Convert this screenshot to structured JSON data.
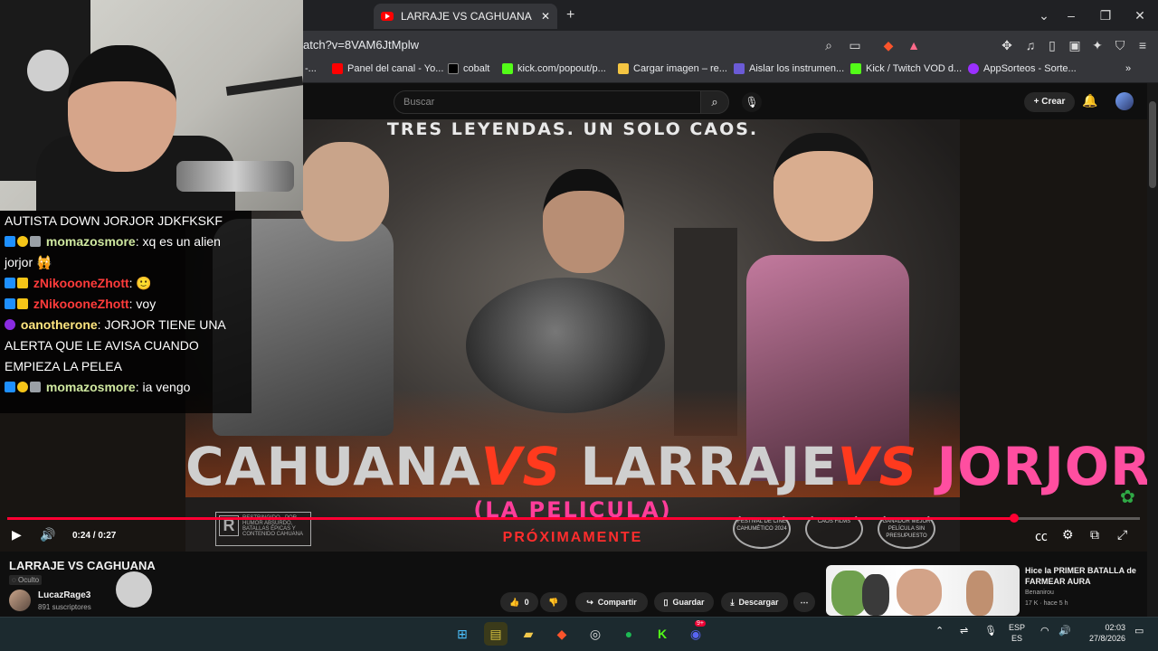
{
  "browser": {
    "tab_title": "LARRAJE VS CAGHUANA - YouTu",
    "new_tab": "+",
    "url": "atch?v=8VAM6JtMplw",
    "window_controls": {
      "collapse": "⌄",
      "minimize": "–",
      "restore": "❐",
      "close": "✕"
    },
    "bookmarks": [
      {
        "label": "-..."
      },
      {
        "label": "Panel del canal - Yo..."
      },
      {
        "label": "cobalt"
      },
      {
        "label": "kick.com/popout/p..."
      },
      {
        "label": "Cargar imagen – re..."
      },
      {
        "label": "Aislar los instrumen..."
      },
      {
        "label": "Kick / Twitch VOD d..."
      },
      {
        "label": "AppSorteos - Sorte..."
      }
    ],
    "bookmarks_more": "»"
  },
  "youtube_header": {
    "search_placeholder": "Buscar",
    "search_icon": "search-icon",
    "mic_icon": "mic-icon",
    "create_label": "Crear",
    "notifications_icon": "bell-icon"
  },
  "poster": {
    "tagline": "TRES LEYENDAS.  UN SOLO CAOS.",
    "title_part1": "CAHUANA",
    "vs1": "VS",
    "title_part2": "LARRAJE",
    "vs2": "VS",
    "title_part3": "JORJOR",
    "subtitle": "(LA PELICULA)",
    "proximamente": "PRÓXIMAMENTE",
    "rating_letter": "R",
    "rating_text": "RESTRINGIDO · POR HUMOR ABSURDO, BATALLAS ÉPICAS Y CONTENIDO CAHUANA",
    "laurels": [
      {
        "text": "FESTIVAL DE CINE CAHUMÉTICO 2024"
      },
      {
        "text": "CAOS FILMS"
      },
      {
        "text": "GANADOR MEJOR PELÍCULA SIN PRESUPUESTO"
      }
    ]
  },
  "player": {
    "time": "0:24 / 0:27",
    "progress_fraction": 0.889,
    "play_icon": "▶",
    "volume_icon": "🔊",
    "subtitles_icon": "cc-icon",
    "settings_icon": "⚙",
    "miniplayer_icon": "miniplayer-icon",
    "fullscreen_icon": "fullscreen-icon"
  },
  "chat": [
    {
      "badges": [],
      "user": "",
      "message": "AUTISTA DOWN JORJOR JDKFKSKF",
      "user_color": "#ffffff"
    },
    {
      "badges": [
        "#1e90ff",
        "#f5c518",
        "#9aa0a6"
      ],
      "user": "momazosmore",
      "message": ": xq es un alien jorjor 🙀",
      "user_color": "#cfe8a0"
    },
    {
      "badges": [
        "#1e90ff",
        "#f5c518"
      ],
      "user": "zNikoooneZhott",
      "message": ": 🙂",
      "user_color": "#ff3b3b"
    },
    {
      "badges": [
        "#1e90ff",
        "#f5c518"
      ],
      "user": "zNikoooneZhott",
      "message": ": voy",
      "user_color": "#ff3b3b"
    },
    {
      "badges": [
        "#8a2be2"
      ],
      "user": "oanotherone",
      "message": ": JORJOR TIENE UNA ALERTA QUE LE AVISA CUANDO EMPIEZA LA PELEA",
      "user_color": "#ffe680"
    },
    {
      "badges": [
        "#1e90ff",
        "#f5c518",
        "#9aa0a6"
      ],
      "user": "momazosmore",
      "message": ": ia vengo",
      "user_color": "#cfe8a0"
    }
  ],
  "video_info": {
    "title": "LARRAJE VS CAGHUANA",
    "visibility": "Oculto",
    "channel": "LucazRage3",
    "subscribers": "891 suscriptores",
    "likes": "0",
    "share": "Compartir",
    "save": "Guardar",
    "download": "Descargar",
    "more": "⋯"
  },
  "recommendation": {
    "title": "Hice la PRIMER BATALLA de FARMEAR AURA",
    "channel": "Benanirou",
    "meta": "17 K · hace 5 h"
  },
  "taskbar": {
    "lang": "ESP",
    "lang_sub": "ES",
    "time": "02:03",
    "date": "27/8/2026",
    "apps": [
      "windows-start-icon",
      "xbox-app-icon",
      "file-explorer-icon",
      "brave-browser-icon",
      "browser-app-icon",
      "spotify-icon",
      "kick-icon",
      "discord-icon"
    ],
    "discord_badge": "9+"
  },
  "colors": {
    "accent_red": "#ff0033",
    "poster_pink": "#ff4ea0",
    "vs_red": "#ff3a1e"
  }
}
